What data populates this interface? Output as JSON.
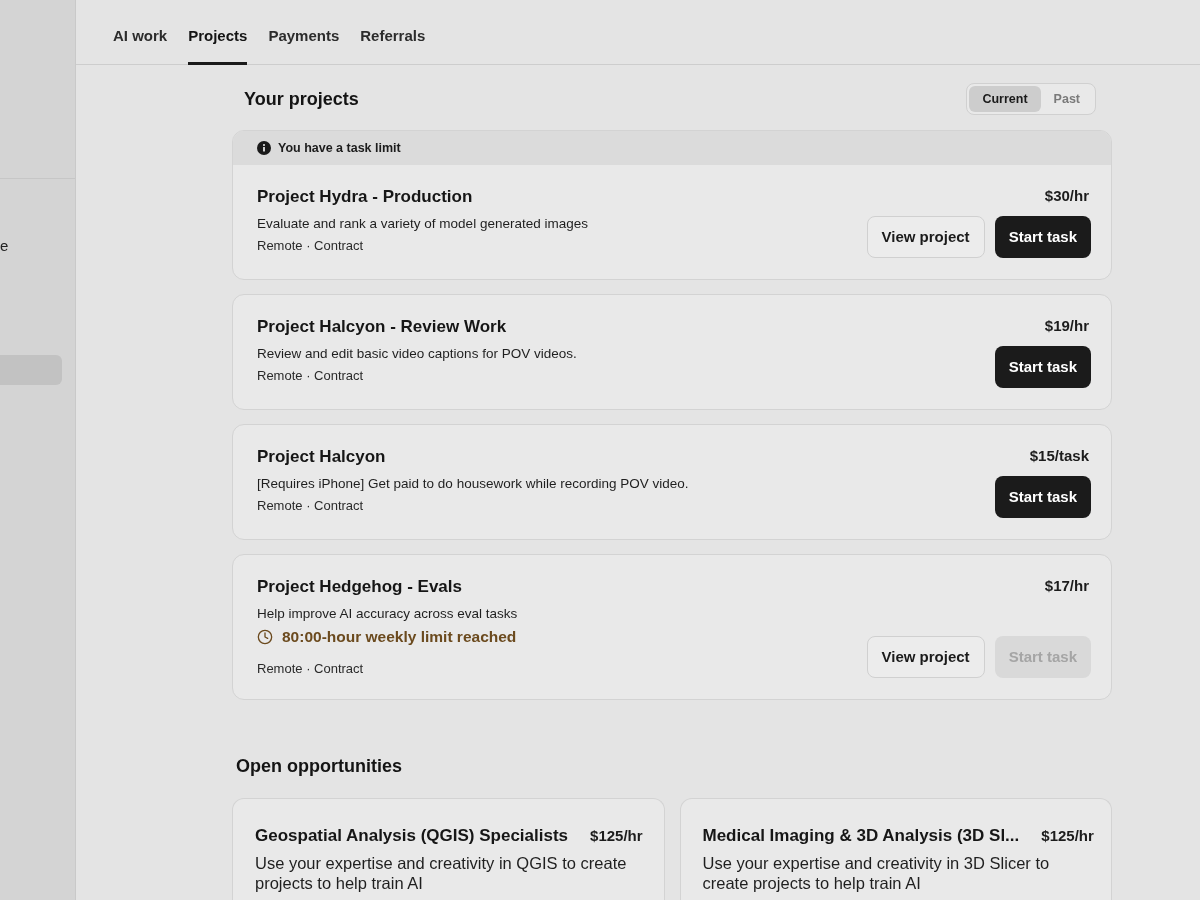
{
  "nav": {
    "tabs": [
      {
        "label": "AI work",
        "selected": false
      },
      {
        "label": "Projects",
        "selected": true
      },
      {
        "label": "Payments",
        "selected": false
      },
      {
        "label": "Referrals",
        "selected": false
      }
    ]
  },
  "sidebar": {
    "items": [
      {
        "label": "e",
        "selected": false
      },
      {
        "selected": true
      }
    ]
  },
  "projects": {
    "title": "Your projects",
    "filter": [
      {
        "label": "Current",
        "selected": true
      },
      {
        "label": "Past",
        "selected": false
      }
    ],
    "cards": [
      {
        "notice": "You have a task limit",
        "title": "Project Hydra - Production",
        "rate": "$30/hr",
        "description": "Evaluate and rank a variety of model generated images",
        "meta": "Remote · Contract",
        "buttons": [
          {
            "kind": "secondary",
            "label": "View project",
            "disabled": false
          },
          {
            "kind": "primary",
            "label": "Start task",
            "disabled": false
          }
        ]
      },
      {
        "title": "Project Halcyon - Review Work",
        "rate": "$19/hr",
        "description": "Review and edit basic video captions for POV videos.",
        "meta": "Remote · Contract",
        "buttons": [
          {
            "kind": "primary",
            "label": "Start task",
            "disabled": false
          }
        ]
      },
      {
        "title": "Project Halcyon",
        "rate": "$15/task",
        "description": "[Requires iPhone] Get paid to do housework while recording POV video.",
        "meta": "Remote · Contract",
        "buttons": [
          {
            "kind": "primary",
            "label": "Start task",
            "disabled": false
          }
        ]
      },
      {
        "title": "Project Hedgehog - Evals",
        "rate": "$17/hr",
        "description": "Help improve AI accuracy across eval tasks",
        "warning": "80:00-hour weekly limit reached",
        "meta": "Remote · Contract",
        "buttons": [
          {
            "kind": "secondary",
            "label": "View project",
            "disabled": false
          },
          {
            "kind": "primary",
            "label": "Start task",
            "disabled": true
          }
        ]
      }
    ]
  },
  "opportunities": {
    "title": "Open opportunities",
    "cards": [
      {
        "title": "Geospatial Analysis (QGIS) Specialists",
        "rate": "$125/hr",
        "description": "Use your expertise and creativity in QGIS to create projects to help train AI"
      },
      {
        "title": "Medical Imaging & 3D Analysis (3D Sl...",
        "rate": "$125/hr",
        "description": "Use your expertise and creativity in 3D Slicer to create projects to help train AI"
      }
    ]
  }
}
